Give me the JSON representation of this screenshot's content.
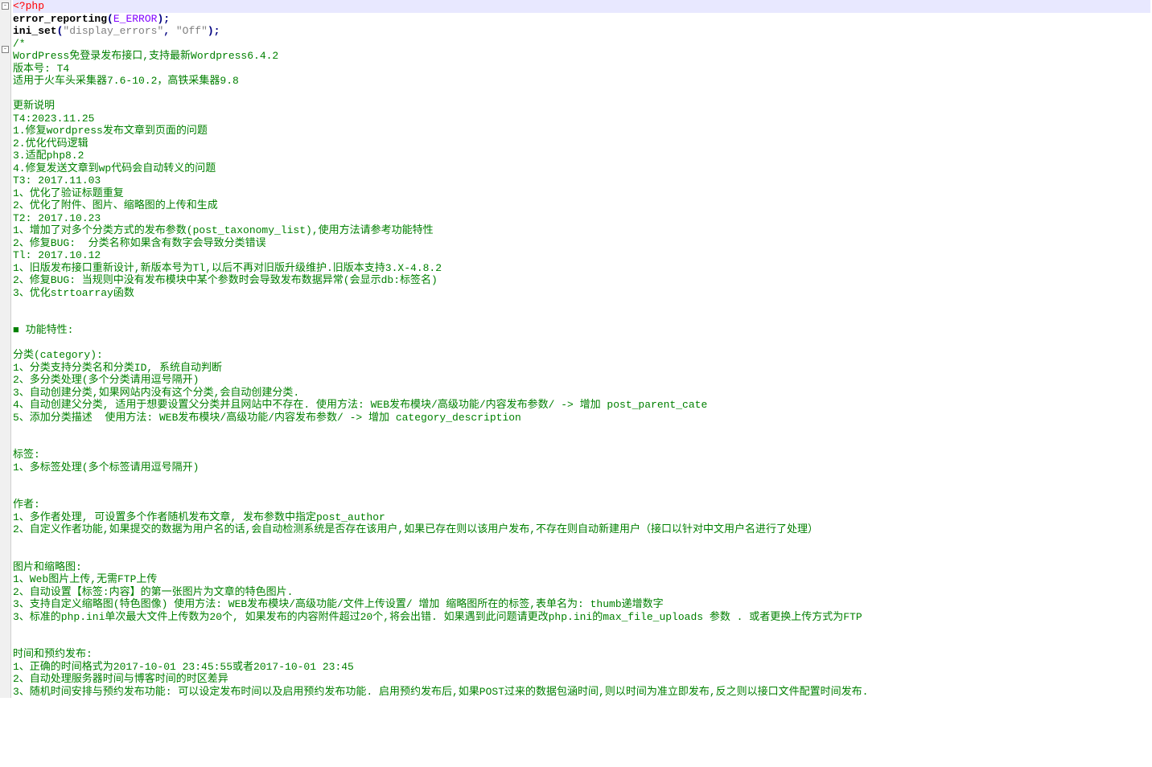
{
  "fold1": "-",
  "fold2": "-",
  "code": {
    "l1_open": "<?php",
    "l2_fn1": "error_reporting",
    "l2_p1": "(",
    "l2_const": "E_ERROR",
    "l2_p2": ");",
    "l3_fn1": "ini_set",
    "l3_p1": "(",
    "l3_s1": "\"display_errors\"",
    "l3_c1": ", ",
    "l3_s2": "\"Off\"",
    "l3_p2": ");",
    "l4_open": "/*"
  },
  "c": {
    "l5": "WordPress免登录发布接口,支持最新Wordpress6.4.2",
    "l6": "版本号: T4",
    "l7": "适用于火车头采集器7.6-10.2，高铁采集器9.8",
    "l8": "",
    "l9": "更新说明",
    "l10": "T4:2023.11.25",
    "l11": "1.修复wordpress发布文章到页面的问题",
    "l12": "2.优化代码逻辑",
    "l13": "3.适配php8.2",
    "l14": "4.修复发送文章到wp代码会自动转义的问题",
    "l15": "T3: 2017.11.03",
    "l16": "1、优化了验证标题重复",
    "l17": "2、优化了附件、图片、缩略图的上传和生成",
    "l18": "T2: 2017.10.23",
    "l19": "1、增加了对多个分类方式的发布参数(post_taxonomy_list),使用方法请参考功能特性",
    "l20": "2、修复BUG:  分类名称如果含有数字会导致分类错误",
    "l21": "Tl: 2017.10.12",
    "l22": "1、旧版发布接口重新设计,新版本号为Tl,以后不再对旧版升级维护.旧版本支持3.X-4.8.2",
    "l23": "2、修复BUG: 当规则中没有发布模块中某个参数时会导致发布数据异常(会显示db:标签名)",
    "l24": "3、优化strtoarray函数",
    "l25": "",
    "l26": "",
    "l27": "■ 功能特性:",
    "l28": "",
    "l29": "分类(category):",
    "l30": "1、分类支持分类名和分类ID, 系统自动判断",
    "l31": "2、多分类处理(多个分类请用逗号隔开)",
    "l32": "3、自动创建分类,如果网站内没有这个分类,会自动创建分类.",
    "l33": "4、自动创建父分类, 适用于想要设置父分类并且网站中不存在. 使用方法: WEB发布模块/高级功能/内容发布参数/ -> 增加 post_parent_cate",
    "l34": "5、添加分类描述  使用方法: WEB发布模块/高级功能/内容发布参数/ -> 增加 category_description",
    "l35": "",
    "l36": "",
    "l37": "标签:",
    "l38": "1、多标签处理(多个标签请用逗号隔开)",
    "l39": "",
    "l40": "",
    "l41": "作者:",
    "l42": "1、多作者处理, 可设置多个作者随机发布文章, 发布参数中指定post_author",
    "l43": "2、自定义作者功能,如果提交的数据为用户名的话,会自动检测系统是否存在该用户,如果已存在则以该用户发布,不存在则自动新建用户（接口以针对中文用户名进行了处理）",
    "l44": "",
    "l45": "",
    "l46": "图片和缩略图:",
    "l47": "1、Web图片上传,无需FTP上传",
    "l48": "2、自动设置【标签:内容】的第一张图片为文章的特色图片.",
    "l49": "3、支持自定义缩略图(特色图像) 使用方法: WEB发布模块/高级功能/文件上传设置/ 增加 缩略图所在的标签,表单名为: thumb递增数字",
    "l50": "3、标准的php.ini单次最大文件上传数为20个, 如果发布的内容附件超过20个,将会出错. 如果遇到此问题请更改php.ini的max_file_uploads 参数 . 或者更换上传方式为FTP",
    "l51": "",
    "l52": "",
    "l53": "时间和预约发布:",
    "l54": "1、正确的时间格式为2017-10-01 23:45:55或者2017-10-01 23:45",
    "l55": "2、自动处理服务器时间与博客时间的时区差异",
    "l56": "3、随机时间安排与预约发布功能: 可以设定发布时间以及启用预约发布功能. 启用预约发布后,如果POST过来的数据包涵时间,则以时间为准立即发布,反之则以接口文件配置时间发布."
  }
}
